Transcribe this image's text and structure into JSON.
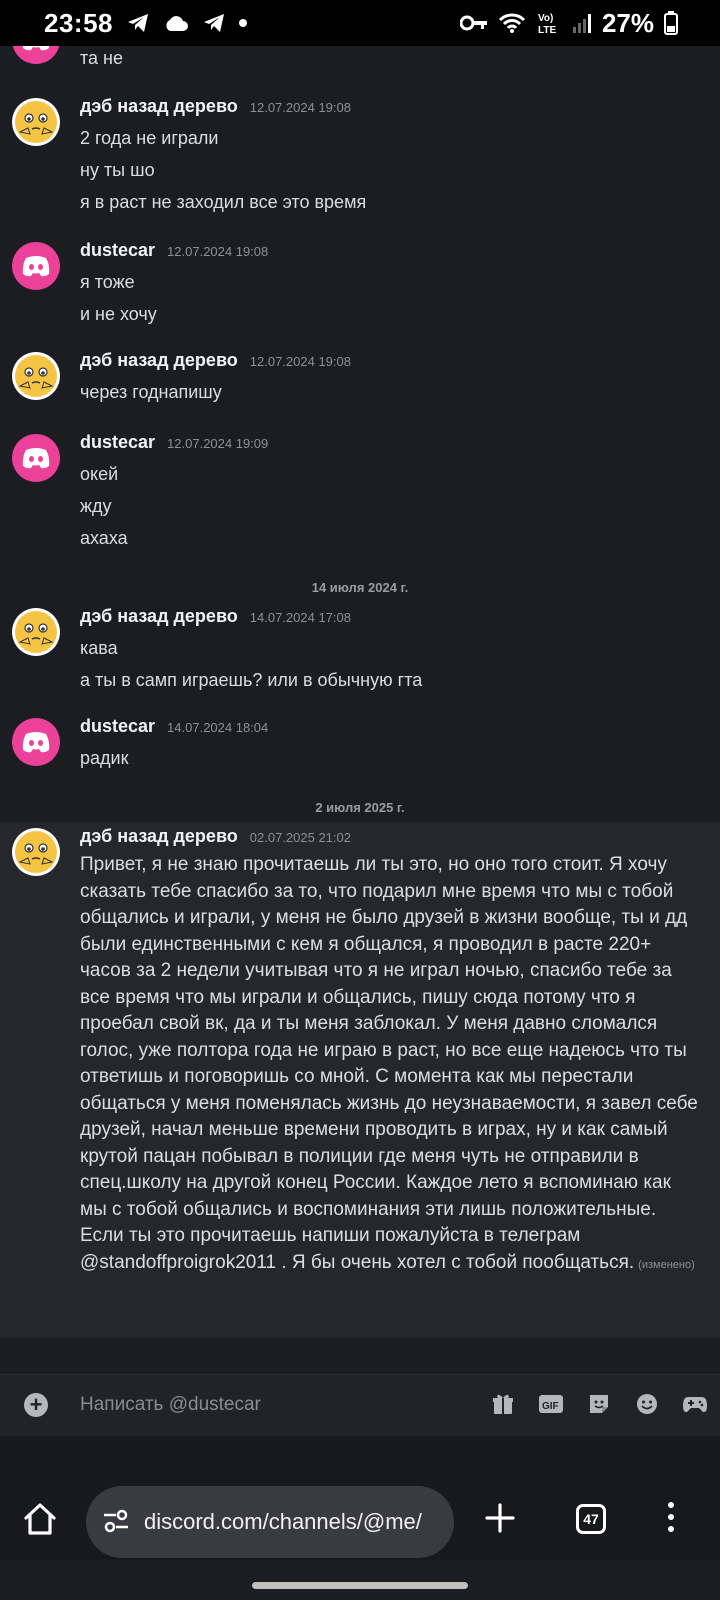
{
  "status_bar": {
    "time": "23:58",
    "battery": "27%",
    "network": "Vo) LTE"
  },
  "top_partial_message": {
    "text": "та не"
  },
  "messages": [
    {
      "username": "дэб назад дерево",
      "timestamp": "12.07.2024 19:08",
      "avatar": "emoji-avatar",
      "lines": [
        "2 года не играли",
        "ну ты шо",
        "я в раст не заходил все это время"
      ]
    },
    {
      "username": "dustecar",
      "timestamp": "12.07.2024 19:08",
      "avatar": "discord-avatar",
      "lines": [
        "я тоже",
        "и не хочу"
      ]
    },
    {
      "username": "дэб назад дерево",
      "timestamp": "12.07.2024 19:08",
      "avatar": "emoji-avatar",
      "lines": [
        "через годнапишу"
      ]
    },
    {
      "username": "dustecar",
      "timestamp": "12.07.2024 19:09",
      "avatar": "discord-avatar",
      "lines": [
        "окей",
        "жду",
        "ахаха"
      ]
    },
    {
      "username": "дэб назад дерево",
      "timestamp": "14.07.2024 17:08",
      "avatar": "emoji-avatar",
      "lines": [
        "кава",
        "а ты в самп играешь? или в обычную гта"
      ]
    },
    {
      "username": "dustecar",
      "timestamp": "14.07.2024 18:04",
      "avatar": "discord-avatar",
      "lines": [
        "радик"
      ]
    },
    {
      "username": "дэб назад дерево",
      "timestamp": "02.07.2025 21:02",
      "avatar": "emoji-avatar",
      "text": "Привет, я не знаю прочитаешь ли ты это, но оно того стоит. Я хочу сказать тебе спасибо за то, что подарил мне время что мы с тобой общались и играли, у меня не было друзей в жизни вообще, ты и дд были единственными с кем я общался, я проводил в расте 220+ часов за 2 недели учитывая что я не играл ночью, спасибо тебе за все время что мы играли и общались, пишу сюда потому что я проебал свой вк, да и ты меня заблокал. У меня давно сломался голос, уже полтора года не играю в раст, но все еще надеюсь что ты ответишь и поговоришь со мной. С момента как мы перестали общаться у меня поменялась жизнь до неузнаваемости, я завел себе друзей, начал меньше времени проводить в играх, ну и как самый крутой пацан побывал в полиции где меня чуть не отправили в спец.школу на другой конец России. Каждое лето я вспоминаю как мы с тобой общались и воспоминания эти лишь положительные. Если ты это прочитаешь напиши пожалуйста в телеграм @standoffproigrok2011 . Я бы очень хотел с тобой пообщаться.",
      "edited": "(изменено)"
    }
  ],
  "date_separators": [
    "14 июля 2024 г.",
    "2 июля 2025 г."
  ],
  "composer": {
    "placeholder": "Написать @dustecar",
    "icons": [
      "gift-icon",
      "gif-icon",
      "sticker-icon",
      "emoji-icon",
      "gamepad-icon"
    ],
    "gif_label": "GIF"
  },
  "browser": {
    "url": "discord.com/channels/@me/",
    "tab_count": "47"
  },
  "colors": {
    "background": "#1c1d22",
    "discord_pink": "#ec4199",
    "username": "#f2f3f5",
    "timestamp": "#8e9097"
  }
}
